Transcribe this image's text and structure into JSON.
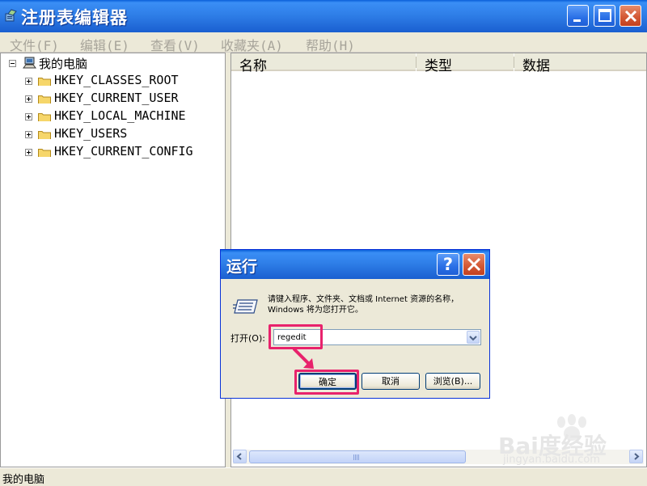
{
  "window": {
    "title": "注册表编辑器"
  },
  "menu": [
    "文件(F)",
    "编辑(E)",
    "查看(V)",
    "收藏夹(A)",
    "帮助(H)"
  ],
  "tree": {
    "root": "我的电脑",
    "keys": [
      "HKEY_CLASSES_ROOT",
      "HKEY_CURRENT_USER",
      "HKEY_LOCAL_MACHINE",
      "HKEY_USERS",
      "HKEY_CURRENT_CONFIG"
    ]
  },
  "columns": [
    "名称",
    "类型",
    "数据"
  ],
  "status": "我的电脑",
  "dialog": {
    "title": "运行",
    "help": "?",
    "description": "请键入程序、文件夹、文档或 Internet 资源的名称，Windows 将为您打开它。",
    "open_label": "打开(O):",
    "input_value": "regedit",
    "buttons": {
      "ok": "确定",
      "cancel": "取消",
      "browse": "浏览(B)..."
    },
    "highlight_color": "#e8226c"
  },
  "watermark": {
    "text": "Bai度经验",
    "sub": "jingyan.baidu.com"
  },
  "colors": {
    "title_blue": "#2f7fe8",
    "close_red": "#d45a36",
    "highlight": "#e8226c"
  }
}
